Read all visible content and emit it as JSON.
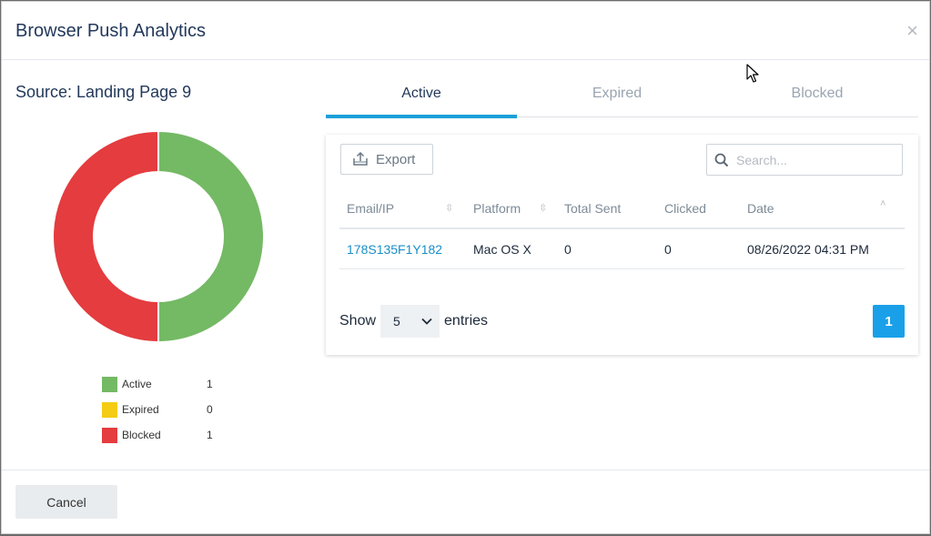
{
  "modal": {
    "title": "Browser Push Analytics",
    "close_symbol": "×",
    "source_label": "Source: Landing Page 9"
  },
  "chart_data": {
    "type": "pie",
    "variant": "donut",
    "categories": [
      "Active",
      "Expired",
      "Blocked"
    ],
    "values": [
      1,
      0,
      1
    ],
    "colors": [
      "#74b964",
      "#f4cc13",
      "#e43c3f"
    ],
    "legend_placement": "bottom"
  },
  "tabs": [
    {
      "label": "Active",
      "selected": true
    },
    {
      "label": "Expired",
      "selected": false
    },
    {
      "label": "Blocked",
      "selected": false
    }
  ],
  "toolbar": {
    "export_label": "Export",
    "export_icon": "export-icon",
    "search_placeholder": "Search...",
    "search_icon": "search-icon"
  },
  "table": {
    "columns": [
      "Email/IP",
      "Platform",
      "Total Sent",
      "Clicked",
      "Date"
    ],
    "rows": [
      [
        "178S135F1Y182",
        "Mac OS X",
        "0",
        "0",
        "08/26/2022 04:31 PM"
      ]
    ]
  },
  "pagination": {
    "show_label": "Show",
    "page_size": "5",
    "entries_label": "entries",
    "current_page": "1"
  },
  "footer": {
    "cancel_label": "Cancel"
  },
  "colors": {
    "accent": "#1aa0d8",
    "title": "#23395b",
    "link": "#1a8ec8"
  }
}
